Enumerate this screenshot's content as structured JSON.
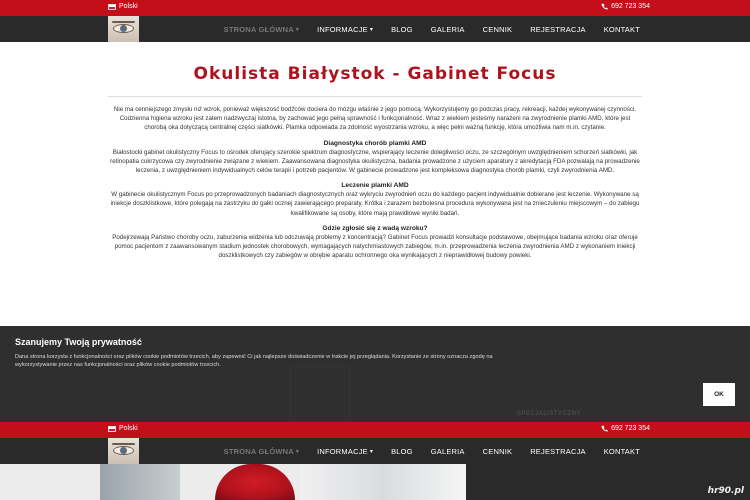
{
  "topbar": {
    "language": "Polski",
    "phone": "692 723 354"
  },
  "nav": {
    "items": [
      {
        "label": "STRONA GŁÓWNA",
        "active": true,
        "dropdown": true
      },
      {
        "label": "INFORMACJE",
        "active": false,
        "dropdown": true
      },
      {
        "label": "BLOG",
        "active": false,
        "dropdown": false
      },
      {
        "label": "GALERIA",
        "active": false,
        "dropdown": false
      },
      {
        "label": "CENNIK",
        "active": false,
        "dropdown": false
      },
      {
        "label": "REJESTRACJA",
        "active": false,
        "dropdown": false
      },
      {
        "label": "KONTAKT",
        "active": false,
        "dropdown": false
      }
    ]
  },
  "content": {
    "title": "Okulista Białystok - Gabinet Focus",
    "intro": "Nie ma cenniejszego zmysłu niż wzrok, ponieważ większość bodźców dociera do mózgu właśnie z jego pomocą. Wykorzystujemy go podczas pracy, rekreacji, każdej wykonywanej czynności. Codzienna higiena wzroku jest zatem nadzwyczaj istotna, by zachować jego pełną sprawność i funkcjonalność. Wraz z wiekiem jesteśmy narażeni na zwyrodnienie plamki AMD, które jest chorobą oka dotyczącą centralnej części siatkówki. Plamka odpowiada za zdolność wyostrzania wzroku, a więc pełni ważną funkcję, która umożliwia nam m.in. czytanie.",
    "sections": [
      {
        "heading": "Diagnostyka chorób plamki AMD",
        "text": "Białostocki gabinet okulistyczny Focus to ośrodek oferujący szerokie spektrum diagnostyczne, wspierający leczenie dolegliwości oczu, ze szczególnym uwzględnieniem schorzeń siatkówki, jak retinopatia cukrzycowa czy zwyrodnienie związane z wiekiem. Zaawansowana diagnostyka okulistyczna, badania prowadzone z użyciem aparatury z akredytacją FDA pozwalają na prowadzenie leczenia, z uwzględnieniem indywidualnych celów terapii i potrzeb pacjentów. W gabinecie prowadzone jest kompleksowa diagnostyka chorób plamki, czyli zwyrodnienia AMD."
      },
      {
        "heading": "Leczenie plamki AMD",
        "text": "W gabinecie okulistycznym Focus po przeprowadzonych badaniach diagnostycznych oraz wykryciu zwyrodnień oczu do każdego pacjent indywidualnie dobierane jest leczenie. Wykonywane są iniekcje doszklistkowe, które polegają na zastrzyku do gałki ocznej zawierającego preparaty. Krótka i zarazem bezbolesna procedura wykonywana jest na znieczuleniu miejscowym – do zabiegu kwalifikowane są osoby, które mają prawidłowe wyniki badań."
      },
      {
        "heading": "Gdzie zgłosić się z wadą wzroku?",
        "text": "Podejrzewają Państwo choroby oczu, zaburzenia widzenia lub odczuwają problemy z koncentracją? Gabinet Focus prowadzi konsultacje podstawowe, obejmujące badania wzroku oraz oferuje pomoc pacjentom z zaawansowanym stadium jednostek chorobowych, wymagających natychmiastowych zabiegów, m.in. przeprowadzenia leczenia zwyrodnienia AMD z wykonaniem iniekcji doszklistkowych czy zabiegów w obrębie aparatu ochronnego oka wynikających z nieprawidłowej budowy powieki."
      }
    ]
  },
  "cookie": {
    "title": "Szanujemy Twoją prywatność",
    "text": "Dana strona korzysta z funkcjonalności oraz plików cookie podmiotów trzecich, aby zapewnić Ci jak najlepsze doświadczenie w trakcie jej przeglądania. Korzystanie ze strony oznacza zgodę na wykorzystywanie przez nas funkcjonalności oraz plików cookie podmiotów trzecich.",
    "ok_label": "OK",
    "background_text": "SPECJALISTYCZNY"
  },
  "watermark": "hr90.pl",
  "colors": {
    "brand_red": "#c40f1b",
    "title_red": "#b0121d",
    "nav_bg": "#2a2a2a",
    "cookie_bg": "#2f2f2f"
  }
}
